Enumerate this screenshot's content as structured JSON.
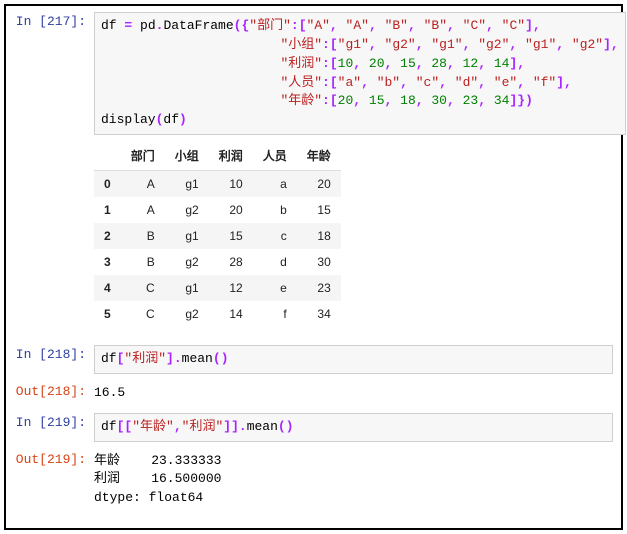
{
  "cells": [
    {
      "kind": "in",
      "prompt": "In [217]:",
      "code_tokens": [
        [
          "txt",
          "df "
        ],
        [
          "op",
          "="
        ],
        [
          "txt",
          " pd"
        ],
        [
          "op",
          "."
        ],
        [
          "txt",
          "DataFrame"
        ],
        [
          "op",
          "("
        ],
        [
          "op",
          "{"
        ],
        [
          "str",
          "\"部门\""
        ],
        [
          "op",
          ":"
        ],
        [
          "op",
          "["
        ],
        [
          "str",
          "\"A\""
        ],
        [
          "op",
          ","
        ],
        [
          "txt",
          " "
        ],
        [
          "str",
          "\"A\""
        ],
        [
          "op",
          ","
        ],
        [
          "txt",
          " "
        ],
        [
          "str",
          "\"B\""
        ],
        [
          "op",
          ","
        ],
        [
          "txt",
          " "
        ],
        [
          "str",
          "\"B\""
        ],
        [
          "op",
          ","
        ],
        [
          "txt",
          " "
        ],
        [
          "str",
          "\"C\""
        ],
        [
          "op",
          ","
        ],
        [
          "txt",
          " "
        ],
        [
          "str",
          "\"C\""
        ],
        [
          "op",
          "]"
        ],
        [
          "op",
          ","
        ],
        [
          "nl",
          ""
        ],
        [
          "txt",
          "                       "
        ],
        [
          "str",
          "\"小组\""
        ],
        [
          "op",
          ":"
        ],
        [
          "op",
          "["
        ],
        [
          "str",
          "\"g1\""
        ],
        [
          "op",
          ","
        ],
        [
          "txt",
          " "
        ],
        [
          "str",
          "\"g2\""
        ],
        [
          "op",
          ","
        ],
        [
          "txt",
          " "
        ],
        [
          "str",
          "\"g1\""
        ],
        [
          "op",
          ","
        ],
        [
          "txt",
          " "
        ],
        [
          "str",
          "\"g2\""
        ],
        [
          "op",
          ","
        ],
        [
          "txt",
          " "
        ],
        [
          "str",
          "\"g1\""
        ],
        [
          "op",
          ","
        ],
        [
          "txt",
          " "
        ],
        [
          "str",
          "\"g2\""
        ],
        [
          "op",
          "]"
        ],
        [
          "op",
          ","
        ],
        [
          "nl",
          ""
        ],
        [
          "txt",
          "                       "
        ],
        [
          "str",
          "\"利润\""
        ],
        [
          "op",
          ":"
        ],
        [
          "op",
          "["
        ],
        [
          "num",
          "10"
        ],
        [
          "op",
          ","
        ],
        [
          "txt",
          " "
        ],
        [
          "num",
          "20"
        ],
        [
          "op",
          ","
        ],
        [
          "txt",
          " "
        ],
        [
          "num",
          "15"
        ],
        [
          "op",
          ","
        ],
        [
          "txt",
          " "
        ],
        [
          "num",
          "28"
        ],
        [
          "op",
          ","
        ],
        [
          "txt",
          " "
        ],
        [
          "num",
          "12"
        ],
        [
          "op",
          ","
        ],
        [
          "txt",
          " "
        ],
        [
          "num",
          "14"
        ],
        [
          "op",
          "]"
        ],
        [
          "op",
          ","
        ],
        [
          "nl",
          ""
        ],
        [
          "txt",
          "                       "
        ],
        [
          "str",
          "\"人员\""
        ],
        [
          "op",
          ":"
        ],
        [
          "op",
          "["
        ],
        [
          "str",
          "\"a\""
        ],
        [
          "op",
          ","
        ],
        [
          "txt",
          " "
        ],
        [
          "str",
          "\"b\""
        ],
        [
          "op",
          ","
        ],
        [
          "txt",
          " "
        ],
        [
          "str",
          "\"c\""
        ],
        [
          "op",
          ","
        ],
        [
          "txt",
          " "
        ],
        [
          "str",
          "\"d\""
        ],
        [
          "op",
          ","
        ],
        [
          "txt",
          " "
        ],
        [
          "str",
          "\"e\""
        ],
        [
          "op",
          ","
        ],
        [
          "txt",
          " "
        ],
        [
          "str",
          "\"f\""
        ],
        [
          "op",
          "]"
        ],
        [
          "op",
          ","
        ],
        [
          "nl",
          ""
        ],
        [
          "txt",
          "                       "
        ],
        [
          "str",
          "\"年龄\""
        ],
        [
          "op",
          ":"
        ],
        [
          "op",
          "["
        ],
        [
          "num",
          "20"
        ],
        [
          "op",
          ","
        ],
        [
          "txt",
          " "
        ],
        [
          "num",
          "15"
        ],
        [
          "op",
          ","
        ],
        [
          "txt",
          " "
        ],
        [
          "num",
          "18"
        ],
        [
          "op",
          ","
        ],
        [
          "txt",
          " "
        ],
        [
          "num",
          "30"
        ],
        [
          "op",
          ","
        ],
        [
          "txt",
          " "
        ],
        [
          "num",
          "23"
        ],
        [
          "op",
          ","
        ],
        [
          "txt",
          " "
        ],
        [
          "num",
          "34"
        ],
        [
          "op",
          "]"
        ],
        [
          "op",
          "}"
        ],
        [
          "op",
          ")"
        ],
        [
          "nl",
          ""
        ],
        [
          "txt",
          "display"
        ],
        [
          "op",
          "("
        ],
        [
          "txt",
          "df"
        ],
        [
          "op",
          ")"
        ]
      ],
      "table": {
        "columns": [
          "部门",
          "小组",
          "利润",
          "人员",
          "年龄"
        ],
        "index": [
          "0",
          "1",
          "2",
          "3",
          "4",
          "5"
        ],
        "rows": [
          [
            "A",
            "g1",
            "10",
            "a",
            "20"
          ],
          [
            "A",
            "g2",
            "20",
            "b",
            "15"
          ],
          [
            "B",
            "g1",
            "15",
            "c",
            "18"
          ],
          [
            "B",
            "g2",
            "28",
            "d",
            "30"
          ],
          [
            "C",
            "g1",
            "12",
            "e",
            "23"
          ],
          [
            "C",
            "g2",
            "14",
            "f",
            "34"
          ]
        ]
      }
    },
    {
      "kind": "in",
      "prompt": "In [218]:",
      "code_tokens": [
        [
          "txt",
          "df"
        ],
        [
          "op",
          "["
        ],
        [
          "str",
          "\"利润\""
        ],
        [
          "op",
          "]"
        ],
        [
          "op",
          "."
        ],
        [
          "txt",
          "mean"
        ],
        [
          "op",
          "("
        ],
        [
          "op",
          ")"
        ]
      ]
    },
    {
      "kind": "out",
      "prompt": "Out[218]:",
      "text": "16.5"
    },
    {
      "kind": "in",
      "prompt": "In [219]:",
      "code_tokens": [
        [
          "txt",
          "df"
        ],
        [
          "op",
          "["
        ],
        [
          "op",
          "["
        ],
        [
          "str",
          "\"年龄\""
        ],
        [
          "op",
          ","
        ],
        [
          "str",
          "\"利润\""
        ],
        [
          "op",
          "]"
        ],
        [
          "op",
          "]"
        ],
        [
          "op",
          "."
        ],
        [
          "txt",
          "mean"
        ],
        [
          "op",
          "("
        ],
        [
          "op",
          ")"
        ]
      ]
    },
    {
      "kind": "out",
      "prompt": "Out[219]:",
      "text": "年龄    23.333333\n利润    16.500000\ndtype: float64"
    }
  ]
}
